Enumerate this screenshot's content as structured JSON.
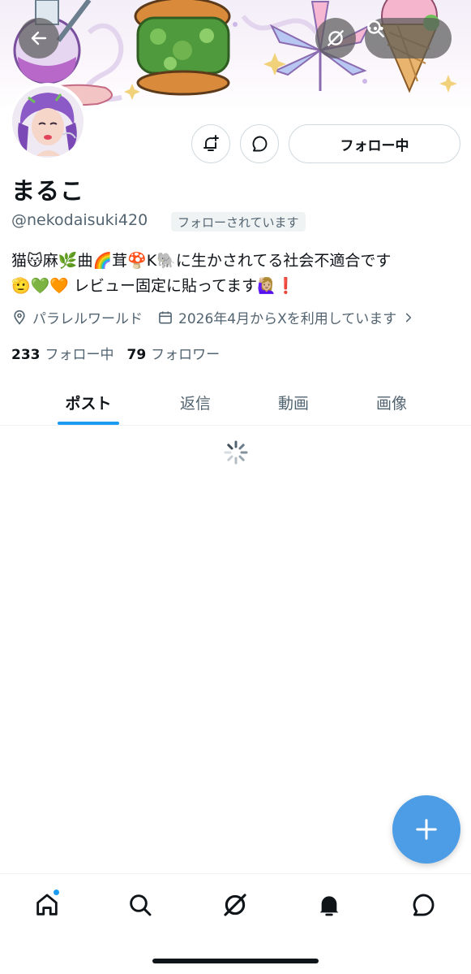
{
  "profile": {
    "display_name": "まるこ",
    "handle": "@nekodaisuki420",
    "follows_you_badge": "フォローされています",
    "bio_line1": "猫😽麻🌿曲🌈茸🍄K🐘に生かされてる社会不適合です",
    "bio_line2": "🫡💚🧡 レビュー固定に貼ってます🙋🏼‍♀️❗",
    "location": "パラレルワールド",
    "joined": "2026年4月からXを利用しています",
    "following_count": "233",
    "following_label": "フォロー中",
    "followers_count": "79",
    "followers_label": "フォロワー"
  },
  "actions": {
    "follow_button": "フォロー中"
  },
  "tabs": [
    {
      "label": "ポスト",
      "active": true
    },
    {
      "label": "返信",
      "active": false
    },
    {
      "label": "動画",
      "active": false
    },
    {
      "label": "画像",
      "active": false
    }
  ],
  "icons": {
    "header": [
      "back-arrow-icon",
      "grok-icon",
      "search-icon",
      "more-icon"
    ],
    "actions": [
      "notification-bell-plus-icon",
      "message-icon"
    ],
    "meta": [
      "location-pin-icon",
      "calendar-icon",
      "chevron-right-icon"
    ],
    "nav": [
      "home-icon",
      "search-icon",
      "grok-icon",
      "notifications-icon",
      "messages-icon"
    ],
    "fab": "plus-icon"
  },
  "colors": {
    "accent": "#1d9bf0",
    "fab": "#4d9de6",
    "secondary_text": "#536471"
  }
}
